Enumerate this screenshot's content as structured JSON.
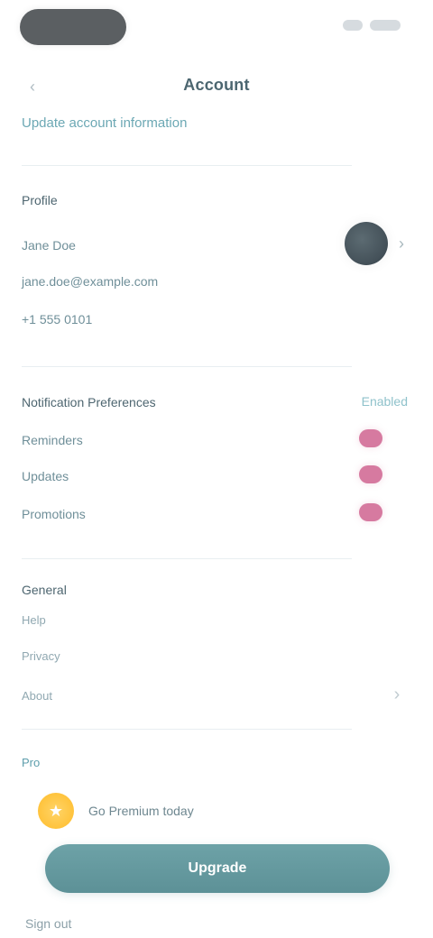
{
  "page": {
    "title": "Account",
    "back_icon": "‹",
    "section_link": "Update account information"
  },
  "profile": {
    "section_title": "Profile",
    "name": "Jane Doe",
    "email": "jane.doe@example.com",
    "phone": "+1 555 0101",
    "chevron": "›"
  },
  "notifications": {
    "title": "Notification Preferences",
    "column": "Enabled",
    "items": [
      {
        "label": "Reminders"
      },
      {
        "label": "Updates"
      },
      {
        "label": "Promotions"
      }
    ]
  },
  "general": {
    "title": "General",
    "items": [
      {
        "label": "Help"
      },
      {
        "label": "Privacy"
      },
      {
        "label": "About"
      }
    ],
    "chevron": "›"
  },
  "promo": {
    "section_title": "Pro",
    "star": "★",
    "text": "Go Premium today",
    "button_label": "Upgrade"
  },
  "footer": {
    "link": "Sign out"
  },
  "colors": {
    "accent": "#6ca8b4",
    "toggle": "#d67aa0",
    "button": "#5d9197",
    "badge": "#ffc33c"
  }
}
